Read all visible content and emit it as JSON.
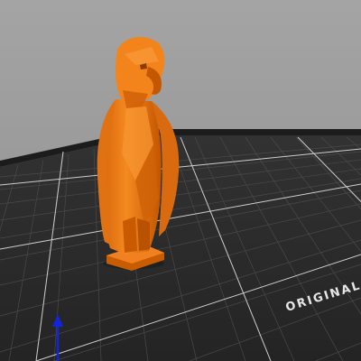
{
  "viewport": {
    "background_color": "#9c9c9c",
    "bed_color": "#2e2e2e",
    "grid_color": "#4a4a4a",
    "grid_major_color": "#d6d6d6",
    "model_color": "#f07a12",
    "model_shadow_color": "#a84d00",
    "axis_y_color": "#1424d8"
  },
  "bed": {
    "label": "ORIGINAL"
  },
  "model": {
    "name_icon": "eagle-model"
  },
  "axes": {
    "y_axis_icon": "y-axis-arrow-icon"
  }
}
